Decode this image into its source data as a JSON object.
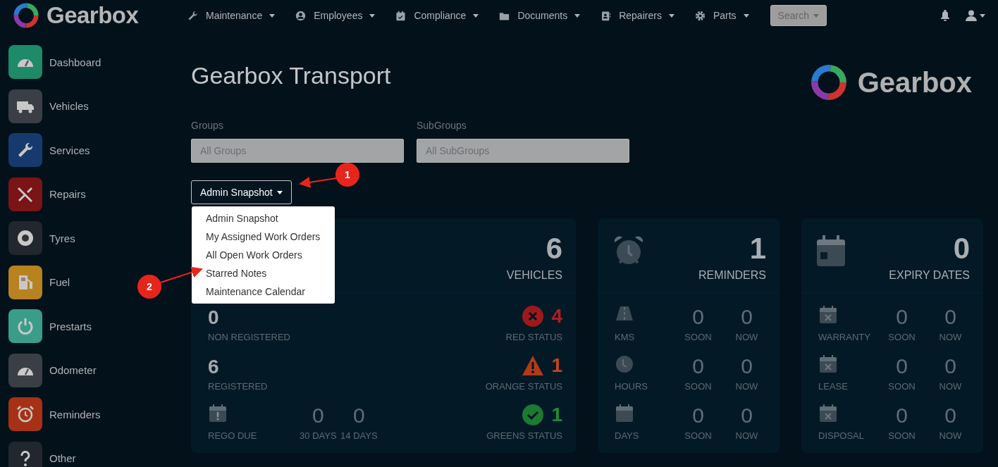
{
  "nav": {
    "brand": "Gearbox",
    "menus": [
      {
        "label": "Maintenance"
      },
      {
        "label": "Employees"
      },
      {
        "label": "Compliance"
      },
      {
        "label": "Documents"
      },
      {
        "label": "Repairers"
      },
      {
        "label": "Parts"
      }
    ],
    "search": "Search"
  },
  "sidebar": {
    "items": [
      {
        "label": "Dashboard",
        "color": "#1e8a68"
      },
      {
        "label": "Vehicles",
        "color": "#3a3f46"
      },
      {
        "label": "Services",
        "color": "#173a6e"
      },
      {
        "label": "Repairs",
        "color": "#7a1416"
      },
      {
        "label": "Tyres",
        "color": "#22262d"
      },
      {
        "label": "Fuel",
        "color": "#b7821f"
      },
      {
        "label": "Prestarts",
        "color": "#3a9d8a"
      },
      {
        "label": "Odometer",
        "color": "#3a3f46"
      },
      {
        "label": "Reminders",
        "color": "#a63116"
      },
      {
        "label": "Other",
        "color": "#22262d"
      }
    ]
  },
  "page": {
    "title": "Gearbox Transport",
    "brand": "Gearbox"
  },
  "filters": [
    {
      "label": "Groups",
      "placeholder": "All Groups"
    },
    {
      "label": "SubGroups",
      "placeholder": "All SubGroups"
    }
  ],
  "view_menu": {
    "label": "Admin Snapshot",
    "expanded": true,
    "options": [
      {
        "label": "Admin Snapshot",
        "selected": false
      },
      {
        "label": "My Assigned Work Orders",
        "selected": false
      },
      {
        "label": "All Open Work Orders",
        "selected": false
      },
      {
        "label": "Starred Notes",
        "selected": false
      },
      {
        "label": "Maintenance Calendar",
        "selected": false
      }
    ]
  },
  "vehicles_card": {
    "count": "6",
    "label": "VEHICLES",
    "left": [
      {
        "kind": "stat",
        "value": "0",
        "label": "NON REGISTERED"
      },
      {
        "kind": "stat",
        "value": "6",
        "label": "REGISTERED"
      },
      {
        "kind": "due",
        "label": "REGO DUE",
        "columns": [
          {
            "value": "0",
            "label": "30 DAYS"
          },
          {
            "value": "0",
            "label": "14 DAYS"
          }
        ]
      }
    ],
    "right": [
      {
        "kind": "error",
        "value": "4",
        "label": "RED STATUS"
      },
      {
        "kind": "warning",
        "value": "1",
        "label": "ORANGE STATUS"
      },
      {
        "kind": "ok",
        "value": "1",
        "label": "GREENS STATUS"
      }
    ]
  },
  "summary_cards": [
    {
      "count": "1",
      "label": "REMINDERS",
      "rows": [
        {
          "label": "KMS",
          "soon": "0",
          "soon_label": "SOON",
          "now": "0",
          "now_label": "NOW"
        },
        {
          "label": "HOURS",
          "soon": "0",
          "soon_label": "SOON",
          "now": "0",
          "now_label": "NOW"
        },
        {
          "label": "DAYS",
          "soon": "0",
          "soon_label": "SOON",
          "now": "0",
          "now_label": "NOW"
        }
      ]
    },
    {
      "count": "0",
      "label": "EXPIRY DATES",
      "rows": [
        {
          "label": "WARRANTY",
          "soon": "0",
          "soon_label": "SOON",
          "now": "0",
          "now_label": "NOW"
        },
        {
          "label": "LEASE",
          "soon": "0",
          "soon_label": "SOON",
          "now": "0",
          "now_label": "NOW"
        },
        {
          "label": "DISPOSAL",
          "soon": "0",
          "soon_label": "SOON",
          "now": "0",
          "now_label": "NOW"
        }
      ]
    }
  ],
  "annotations": [
    {
      "label": "1"
    },
    {
      "label": "2"
    }
  ]
}
